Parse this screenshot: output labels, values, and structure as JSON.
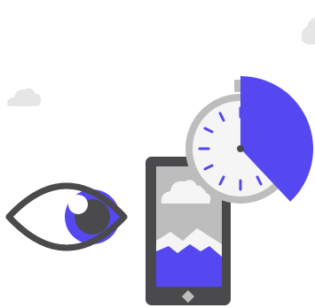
{
  "scene": {
    "description_free": true,
    "icons": [
      "cloud-icon",
      "eye-icon",
      "smartphone-icon",
      "stopwatch-icon",
      "mountain-landscape-icon"
    ],
    "timer_fraction_elapsed": 0.38
  },
  "colors": {
    "background": "#ffffff",
    "accent": "#5548f0",
    "dark": "#4a4a4c",
    "mid_gray": "#bdbdbd",
    "light_gray": "#e0e0e0",
    "clock_face": "#f5f5f5",
    "cloud": "#e6e6e6"
  }
}
